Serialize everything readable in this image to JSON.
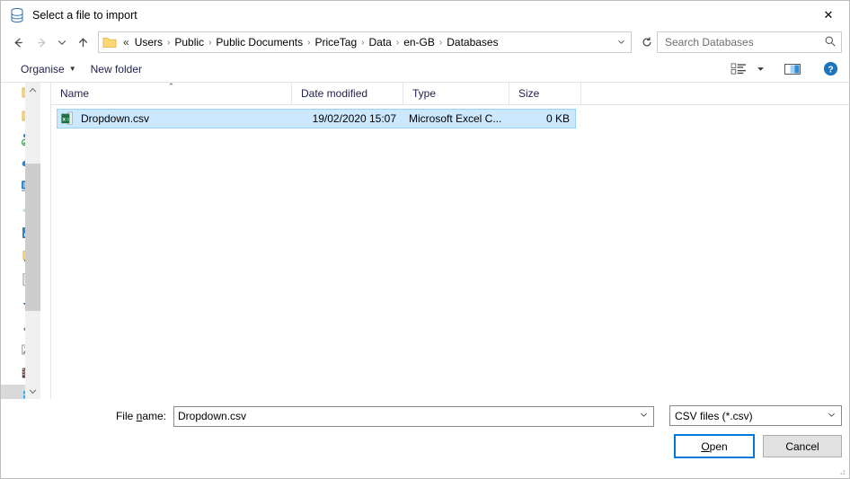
{
  "window": {
    "title": "Select a file to import",
    "title_icon": "database-icon",
    "close_label": "✕"
  },
  "nav": {
    "back_icon": "arrow-left-icon",
    "forward_icon": "arrow-right-icon",
    "recent_icon": "chevron-down-icon",
    "up_icon": "arrow-up-icon",
    "refresh_icon": "refresh-icon",
    "address_prefix": "«",
    "breadcrumbs": [
      "Users",
      "Public",
      "Public Documents",
      "PriceTag",
      "Data",
      "en-GB",
      "Databases"
    ],
    "separator": "›",
    "dropdown_caret": "⌄"
  },
  "search": {
    "placeholder": "Search Databases",
    "value": "",
    "icon": "search-icon"
  },
  "toolbar": {
    "organise_label": "Organise",
    "organise_caret": "▼",
    "new_folder_label": "New folder",
    "view_icon": "view-options-icon",
    "view_caret": "▼",
    "preview_icon": "preview-pane-icon",
    "help_icon": "help-icon",
    "help_glyph": "?"
  },
  "sidebar": {
    "items": [
      {
        "name": "folder",
        "icon": "folder-icon"
      },
      {
        "name": "folder",
        "icon": "folder-icon"
      },
      {
        "name": "shared-folder",
        "icon": "shared-people-icon"
      },
      {
        "name": "onedrive",
        "icon": "cloud-icon"
      },
      {
        "name": "this-pc",
        "icon": "monitor-icon"
      },
      {
        "name": "3d-objects",
        "icon": "three-d-objects-icon"
      },
      {
        "name": "desktop",
        "icon": "desktop-icon"
      },
      {
        "name": "documents-folder",
        "icon": "folder-green-icon"
      },
      {
        "name": "documents",
        "icon": "documents-icon"
      },
      {
        "name": "downloads",
        "icon": "download-arrow-icon"
      },
      {
        "name": "music",
        "icon": "music-note-icon"
      },
      {
        "name": "pictures",
        "icon": "pictures-icon"
      },
      {
        "name": "videos",
        "icon": "videos-icon"
      },
      {
        "name": "network",
        "icon": "network-icon",
        "selected": true
      }
    ],
    "scroll_up": "⌃",
    "scroll_down": "⌄"
  },
  "file_list": {
    "columns": [
      {
        "label": "Name",
        "sorted": "asc",
        "sort_glyph": "⌃"
      },
      {
        "label": "Date modified"
      },
      {
        "label": "Type"
      },
      {
        "label": "Size"
      }
    ],
    "rows": [
      {
        "icon": "excel-csv-icon",
        "name": "Dropdown.csv",
        "date_modified": "19/02/2020 15:07",
        "type": "Microsoft Excel C...",
        "size": "0 KB",
        "selected": true
      }
    ]
  },
  "footer": {
    "filename_label_pre": "File ",
    "filename_label_accel": "n",
    "filename_label_post": "ame:",
    "filename_value": "Dropdown.csv",
    "filename_caret": "⌄",
    "filter_value": "CSV files (*.csv)",
    "filter_caret": "⌄",
    "open_label_accel": "O",
    "open_label_post": "pen",
    "cancel_label": "Cancel"
  },
  "colors": {
    "accent": "#0078d7",
    "selection_bg": "#cce8ff",
    "selection_border": "#99d1ff",
    "breadcrumb_text": "#000000",
    "toolbar_text": "#1f1f4d"
  }
}
